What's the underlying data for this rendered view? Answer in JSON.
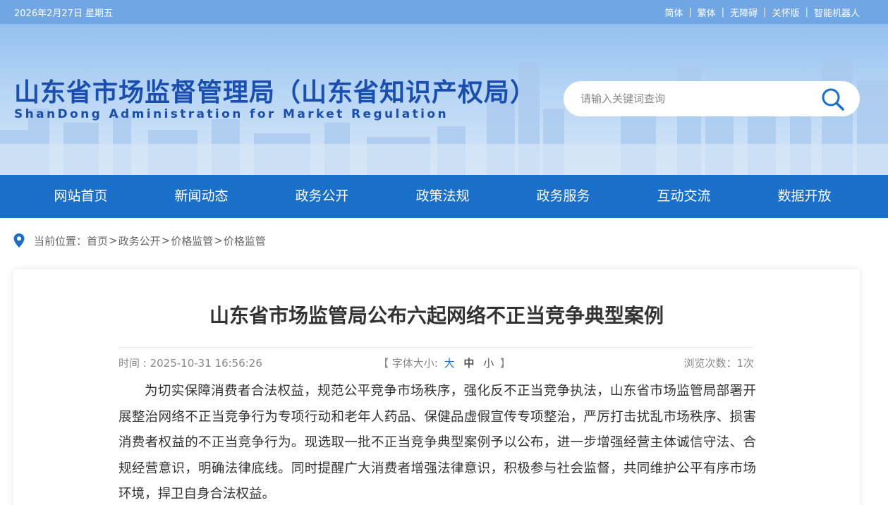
{
  "topbar": {
    "date": "2026年2月27日 星期五",
    "links": [
      "简体",
      "繁体",
      "无障碍",
      "关怀版",
      "智能机器人"
    ],
    "separator": "|"
  },
  "header": {
    "title": "山东省市场监督管理局（山东省知识产权局）",
    "subtitle": "ShanDong Administration for Market Regulation",
    "search_placeholder": "请输入关键词查询",
    "search_icon": "search-icon"
  },
  "nav": {
    "items": [
      "网站首页",
      "新闻动态",
      "政务公开",
      "政策法规",
      "政务服务",
      "互动交流",
      "数据开放"
    ]
  },
  "breadcrumb": {
    "icon": "location-pin-icon",
    "label": "当前位置：",
    "items": [
      "首页",
      "政务公开",
      "价格监管",
      "价格监管"
    ],
    "sep": ">"
  },
  "article": {
    "title": "山东省市场监管局公布六起网络不正当竞争典型案例",
    "time": "时间 : 2025-10-31 16:56:26",
    "font_size_open": "【 字体大小:",
    "font_size_options": [
      "大",
      "中",
      "小"
    ],
    "font_size_close": "】",
    "views": "浏览次数：1次",
    "paragraph": "为切实保障消费者合法权益，规范公平竞争市场秩序，强化反不正当竞争执法，山东省市场监管局部署开展整治网络不正当竞争行为专项行动和老年人药品、保健品虚假宣传专项整治，严厉打击扰乱市场秩序、损害消费者权益的不正当竞争行为。现选取一批不正当竞争典型案例予以公布，进一步增强经营主体诚信守法、合规经营意识，明确法律底线。同时提醒广大消费者增强法律意识，积极参与社会监督，共同维护公平有序市场环境，捍卫自身合法权益。"
  },
  "colors": {
    "topbar": "#6fa6e3",
    "nav": "#1a6fc9",
    "title_blue": "#1a4fb0"
  }
}
